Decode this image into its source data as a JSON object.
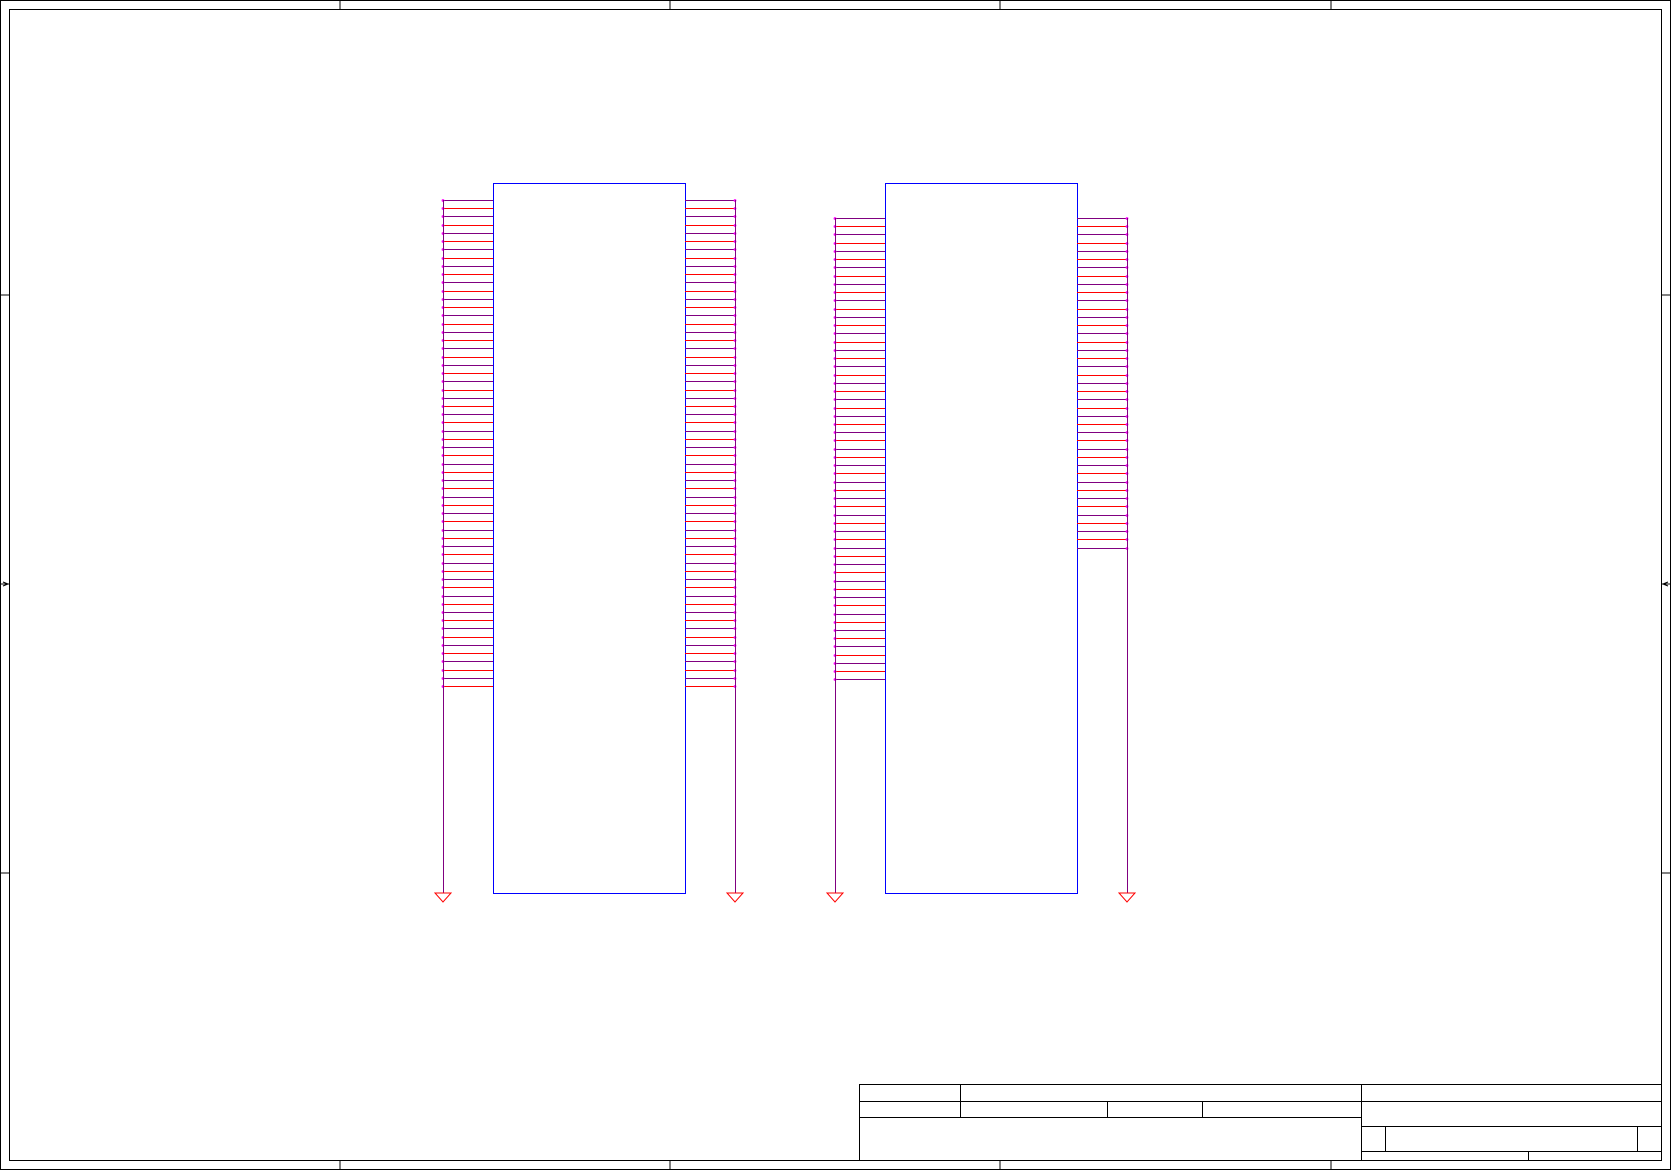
{
  "diagram": {
    "kind": "schematic-sheet",
    "colors": {
      "border": "#000000",
      "component_outline": "#0000ff",
      "pin_wire": "#ff0000",
      "net_wire": "#800080",
      "junction": "#ff00ff",
      "ground_symbol": "#ff0000"
    },
    "components": [
      {
        "id": "component-1",
        "left_pins": 60,
        "right_pins": 60,
        "left_ground": true,
        "right_ground": true
      },
      {
        "id": "component-2",
        "left_pins": 57,
        "right_pins": 41,
        "left_ground": true,
        "right_ground": true
      }
    ],
    "title_block": {
      "visible_text": []
    }
  }
}
